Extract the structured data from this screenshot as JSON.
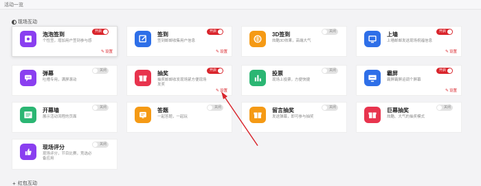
{
  "header": {
    "title": "活动一览"
  },
  "sections": {
    "live": "现场互动",
    "redpacket": "红包互动"
  },
  "setting_label": "设置",
  "cards": [
    {
      "name": "泡泡签到",
      "desc": "个性签，增加用户签到参与感",
      "toggle": "开启",
      "on": true,
      "color": "#8a3ff0",
      "icon": "bubble-icon"
    },
    {
      "name": "签到",
      "desc": "签到邮邮收集用户信息",
      "toggle": "开启",
      "on": true,
      "color": "#2e6fe8",
      "icon": "edit-icon"
    },
    {
      "name": "3D签到",
      "desc": "炫酷3D效果，高端大气",
      "toggle": "关闭",
      "on": false,
      "color": "#f59a15",
      "icon": "globe-icon"
    },
    {
      "name": "上墙",
      "desc": "上墙邮邮发送现场祝福信息",
      "toggle": "开启",
      "on": true,
      "color": "#2e6fe8",
      "icon": "wall-icon"
    },
    {
      "name": "弹幕",
      "desc": "吐槽专用，满屏滚动",
      "toggle": "关闭",
      "on": false,
      "color": "#8a3ff0",
      "icon": "chat-icon"
    },
    {
      "name": "抽奖",
      "desc": "抽奖邮邮收发现场紧方便现场发奖",
      "toggle": "开启",
      "on": true,
      "color": "#e8344e",
      "icon": "gift-icon"
    },
    {
      "name": "投票",
      "desc": "现场上投票，方便快捷",
      "toggle": "关闭",
      "on": false,
      "color": "#2bb673",
      "icon": "chart-icon"
    },
    {
      "name": "霸屏",
      "desc": "霸屏霸屏运调个屏幕",
      "toggle": "开启",
      "on": true,
      "color": "#2e6fe8",
      "icon": "screen-icon"
    },
    {
      "name": "开幕墙",
      "desc": "展示活动流程的页面",
      "toggle": "关闭",
      "on": false,
      "color": "#2bb673",
      "icon": "curtain-icon"
    },
    {
      "name": "答题",
      "desc": "一起答题，一起玩",
      "toggle": "关闭",
      "on": false,
      "color": "#f59a15",
      "icon": "quiz-icon"
    },
    {
      "name": "留言抽奖",
      "desc": "发送弹幕，即可参与抽奖",
      "toggle": "关闭",
      "on": false,
      "color": "#f59a15",
      "icon": "message-gift-icon"
    },
    {
      "name": "巨幕抽奖",
      "desc": "炫酷、大气的抽奖模式",
      "toggle": "关闭",
      "on": false,
      "color": "#e8344e",
      "icon": "big-gift-icon"
    },
    {
      "name": "现场评分",
      "desc": "现场评分，节目比赛，竞选必备应用",
      "toggle": "关闭",
      "on": false,
      "color": "#8a3ff0",
      "icon": "thumb-icon"
    }
  ]
}
